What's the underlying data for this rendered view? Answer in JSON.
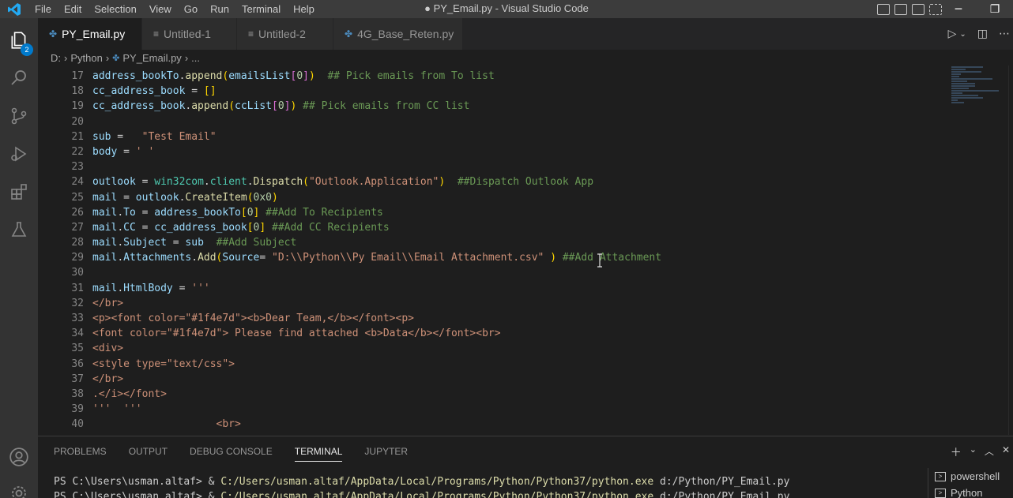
{
  "window": {
    "title": "● PY_Email.py - Visual Studio Code",
    "menu": [
      "File",
      "Edit",
      "Selection",
      "View",
      "Go",
      "Run",
      "Terminal",
      "Help"
    ],
    "controls": {
      "minimize": "─",
      "restore": "❐",
      "close": "✕"
    }
  },
  "activity_bar": {
    "items": [
      "explorer-icon",
      "search-icon",
      "source-control-icon",
      "run-debug-icon",
      "extensions-icon",
      "testing-icon"
    ],
    "explorer_badge": "2",
    "bottom": [
      "account-icon",
      "settings-icon"
    ]
  },
  "tabs": [
    {
      "label": "PY_Email.py",
      "icon": "python-icon",
      "modified": true,
      "active": true
    },
    {
      "label": "Untitled-1",
      "icon": "text-file-icon",
      "modified": false,
      "active": false
    },
    {
      "label": "Untitled-2",
      "icon": "text-file-icon",
      "modified": false,
      "active": false
    },
    {
      "label": "4G_Base_Reten.py",
      "icon": "python-icon",
      "modified": true,
      "active": false
    }
  ],
  "breadcrumb": [
    "D:",
    "Python",
    "PY_Email.py",
    "..."
  ],
  "editor": {
    "line_numbers": [
      "17",
      "18",
      "19",
      "20",
      "21",
      "22",
      "23",
      "24",
      "25",
      "26",
      "27",
      "28",
      "29",
      "30",
      "31",
      "32",
      "33",
      "34",
      "35",
      "36",
      "37",
      "38",
      "39",
      "40"
    ],
    "lines": [
      "address_bookTo.append(emailsList[0])  ## Pick emails from To list",
      "cc_address_book = []",
      "cc_address_book.append(ccList[0]) ## Pick emails from CC list",
      "",
      "sub =   \"Test Email\"",
      "body = ' '",
      "",
      "outlook = win32com.client.Dispatch(\"Outlook.Application\")  ##Dispatch Outlook App",
      "mail = outlook.CreateItem(0x0)",
      "mail.To = address_bookTo[0] ##Add To Recipients",
      "mail.CC = cc_address_book[0] ##Add CC Recipients",
      "mail.Subject = sub  ##Add Subject",
      "mail.Attachments.Add(Source= \"D:\\\\Python\\\\Py Email\\\\Email Attachment.csv\" ) ##Add Attachment",
      "",
      "mail.HtmlBody = '''",
      "</br>",
      "<p><font color=\"#1f4e7d\"><b>Dear Team,</b></font><p>",
      "<font color=\"#1f4e7d\"> Please find attached <b>Data</b></font><br>",
      "<div>",
      "<style type=\"text/css\">",
      "</br>",
      ".</i></font>",
      "'''  '''",
      "                    <br>"
    ]
  },
  "panel": {
    "tabs": [
      "PROBLEMS",
      "OUTPUT",
      "DEBUG CONSOLE",
      "TERMINAL",
      "JUPYTER"
    ],
    "active_tab": "TERMINAL",
    "terminal_lines": [
      {
        "prompt": "PS C:\\Users\\usman.altaf> & ",
        "cmd": "C:/Users/usman.altaf/AppData/Local/Programs/Python/Python37/python.exe",
        "arg": " d:/Python/PY_Email.py"
      },
      {
        "prompt": "PS C:\\Users\\usman.altaf> & ",
        "cmd": "C:/Users/usman.altaf/AppData/Local/Programs/Python/Python37/python.exe",
        "arg": " d:/Python/PY_Email.py"
      }
    ],
    "terminals": [
      "powershell",
      "Python"
    ]
  },
  "colors": {
    "accent": "#007acc",
    "titlebar": "#3c3c3c",
    "activity_bar": "#333333",
    "editor_bg": "#1e1e1e"
  }
}
